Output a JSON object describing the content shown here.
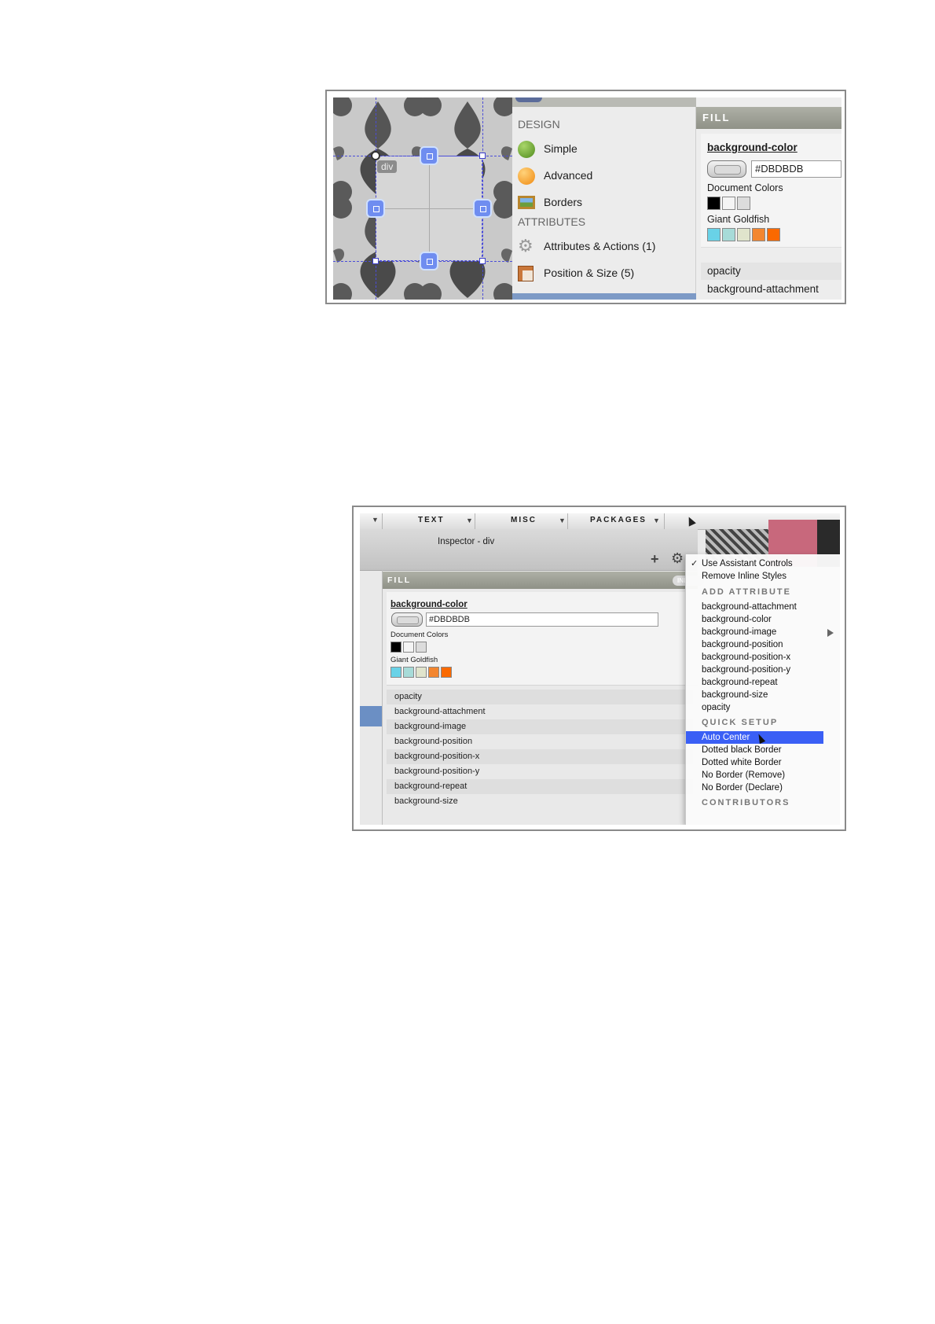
{
  "shot1": {
    "canvas": {
      "div_label": "div"
    },
    "design_panel": {
      "section_design": "DESIGN",
      "items": [
        {
          "label": "Simple",
          "icon": "green-circle-icon"
        },
        {
          "label": "Advanced",
          "icon": "orange-circle-icon"
        },
        {
          "label": "Borders",
          "icon": "picture-frame-icon"
        }
      ],
      "section_attributes": "ATTRIBUTES",
      "attr_items": [
        {
          "label": "Attributes & Actions (1)",
          "icon": "gear-icon"
        },
        {
          "label": "Position & Size (5)",
          "icon": "ruler-icon"
        }
      ]
    },
    "fill_panel": {
      "header": "FILL",
      "property": "background-color",
      "value": "#DBDBDB",
      "document_colors_label": "Document Colors",
      "document_colors": [
        "#000000",
        "#f4f4f4",
        "#dcdcdc"
      ],
      "palette_label": "Giant Goldfish",
      "palette_colors": [
        "#69d2e7",
        "#a7dbd8",
        "#e0e4cc",
        "#f38630",
        "#fa6900"
      ],
      "rows": [
        "opacity",
        "background-attachment"
      ]
    }
  },
  "shot2": {
    "toolbar": {
      "tabs": [
        "TEXT",
        "MISC",
        "PACKAGES"
      ]
    },
    "inspector_title": "Inspector - div",
    "fill_panel": {
      "header": "FILL",
      "badge": "INL",
      "property": "background-color",
      "value": "#DBDBDB",
      "document_colors_label": "Document Colors",
      "document_colors": [
        "#000000",
        "#f4f4f4",
        "#dcdcdc"
      ],
      "palette_label": "Giant Goldfish",
      "palette_colors": [
        "#69d2e7",
        "#a7dbd8",
        "#e0e4cc",
        "#f38630",
        "#fa6900"
      ],
      "rows": [
        "opacity",
        "background-attachment",
        "background-image",
        "background-position",
        "background-position-x",
        "background-position-y",
        "background-repeat",
        "background-size"
      ]
    },
    "context_menu": {
      "top_items": [
        "Use Assistant Controls",
        "Remove Inline Styles"
      ],
      "checkmark": "✓",
      "section_add": "ADD ATTRIBUTE",
      "add_items": [
        "background-attachment",
        "background-color",
        "background-image",
        "background-position",
        "background-position-x",
        "background-position-y",
        "background-repeat",
        "background-size",
        "opacity"
      ],
      "section_quick": "QUICK SETUP",
      "quick_items": [
        "Auto Center",
        "Dotted black Border",
        "Dotted white Border",
        "No Border (Remove)",
        "No Border (Declare)"
      ],
      "section_contributors": "CONTRIBUTORS",
      "highlight_color": "#3a5ff5"
    }
  }
}
